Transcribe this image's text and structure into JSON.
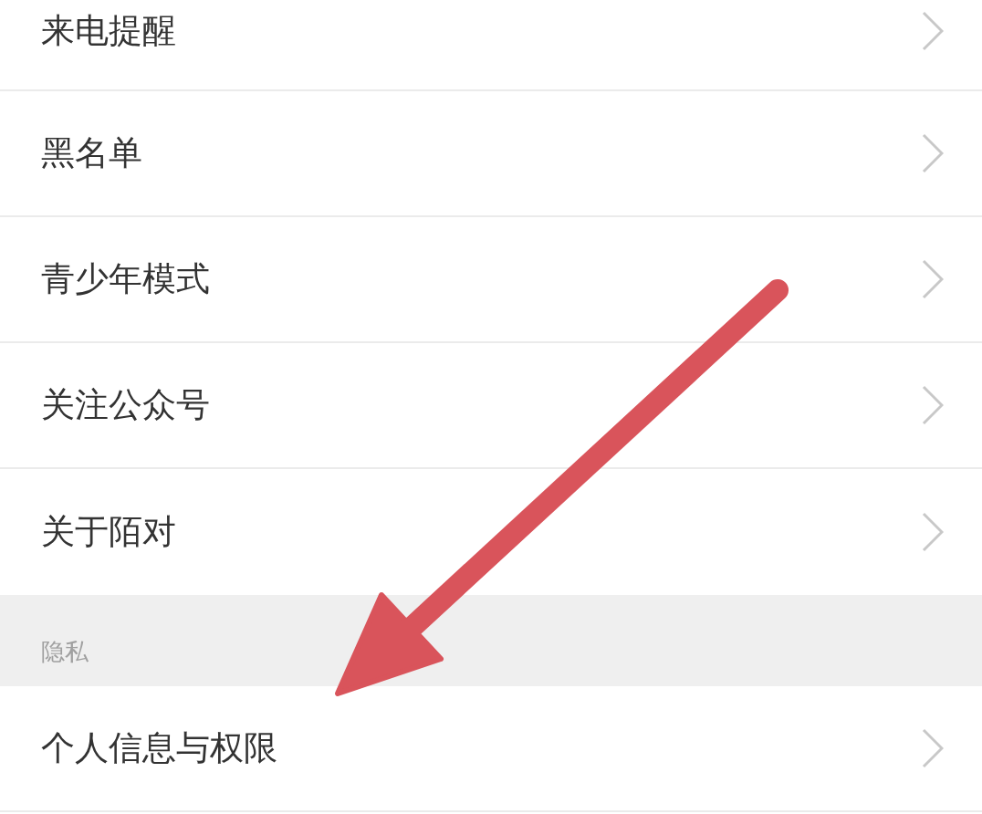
{
  "sections": [
    {
      "items": [
        {
          "label": "来电提醒"
        },
        {
          "label": "黑名单"
        },
        {
          "label": "青少年模式"
        },
        {
          "label": "关注公众号"
        },
        {
          "label": "关于陌对"
        }
      ]
    },
    {
      "title": "隐私",
      "items": [
        {
          "label": "个人信息与权限"
        }
      ]
    }
  ]
}
